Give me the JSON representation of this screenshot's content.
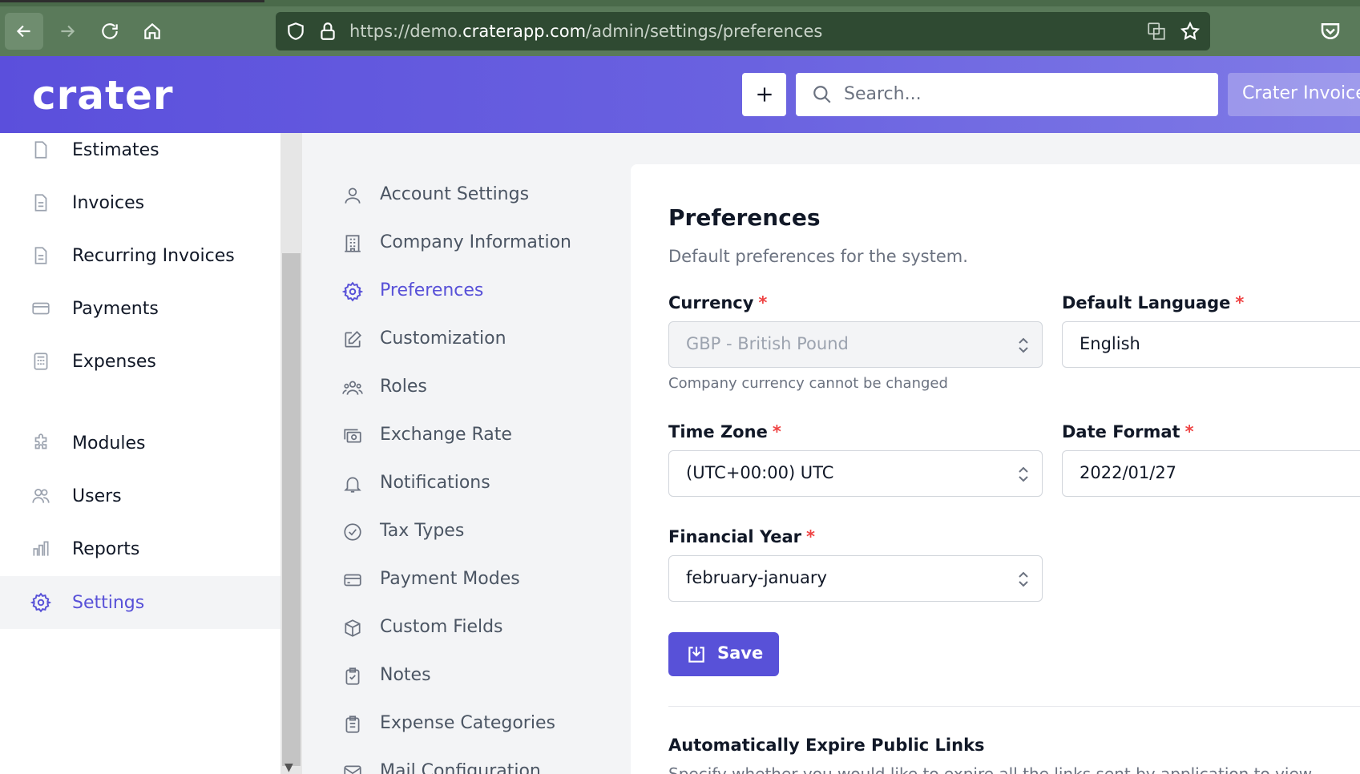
{
  "browser": {
    "url_prefix": "https://demo.",
    "url_domain": "craterapp.com",
    "url_path": "/admin/settings/preferences"
  },
  "header": {
    "logo": "crater",
    "search_placeholder": "Search...",
    "company_button": "Crater Invoice"
  },
  "sidebar": {
    "items": [
      {
        "label": "Estimates",
        "icon": "document-icon"
      },
      {
        "label": "Invoices",
        "icon": "document-text-icon"
      },
      {
        "label": "Recurring Invoices",
        "icon": "document-text-icon"
      },
      {
        "label": "Payments",
        "icon": "credit-card-icon"
      },
      {
        "label": "Expenses",
        "icon": "calculator-icon"
      },
      {
        "label": "Modules",
        "icon": "puzzle-icon"
      },
      {
        "label": "Users",
        "icon": "users-icon"
      },
      {
        "label": "Reports",
        "icon": "chart-bar-icon"
      },
      {
        "label": "Settings",
        "icon": "cog-icon",
        "active": true
      }
    ]
  },
  "settings_nav": {
    "items": [
      {
        "label": "Account Settings",
        "icon": "user-icon"
      },
      {
        "label": "Company Information",
        "icon": "office-building-icon"
      },
      {
        "label": "Preferences",
        "icon": "cog-icon",
        "active": true
      },
      {
        "label": "Customization",
        "icon": "pencil-square-icon"
      },
      {
        "label": "Roles",
        "icon": "user-group-icon"
      },
      {
        "label": "Exchange Rate",
        "icon": "cash-icon"
      },
      {
        "label": "Notifications",
        "icon": "bell-icon"
      },
      {
        "label": "Tax Types",
        "icon": "check-circle-icon"
      },
      {
        "label": "Payment Modes",
        "icon": "credit-card-icon"
      },
      {
        "label": "Custom Fields",
        "icon": "cube-icon"
      },
      {
        "label": "Notes",
        "icon": "clipboard-check-icon"
      },
      {
        "label": "Expense Categories",
        "icon": "clipboard-list-icon"
      },
      {
        "label": "Mail Configuration",
        "icon": "mail-icon"
      }
    ]
  },
  "preferences": {
    "title": "Preferences",
    "subtitle": "Default preferences for the system.",
    "currency": {
      "label": "Currency",
      "value": "GBP - British Pound",
      "hint": "Company currency cannot be changed"
    },
    "language": {
      "label": "Default Language",
      "value": "English"
    },
    "timezone": {
      "label": "Time Zone",
      "value": "(UTC+00:00) UTC"
    },
    "date_format": {
      "label": "Date Format",
      "value": "2022/01/27"
    },
    "financial_year": {
      "label": "Financial Year",
      "value": "february-january"
    },
    "required_mark": "*",
    "save_label": "Save",
    "expire_title": "Automatically Expire Public Links",
    "expire_desc": "Specify whether you would like to expire all the links sent by application to view"
  },
  "colors": {
    "primary": "#5851d8",
    "header_start": "#5b4fdc",
    "header_end": "#7f7ae6",
    "browser_green": "#5a7a5a",
    "required": "#ef4444"
  }
}
